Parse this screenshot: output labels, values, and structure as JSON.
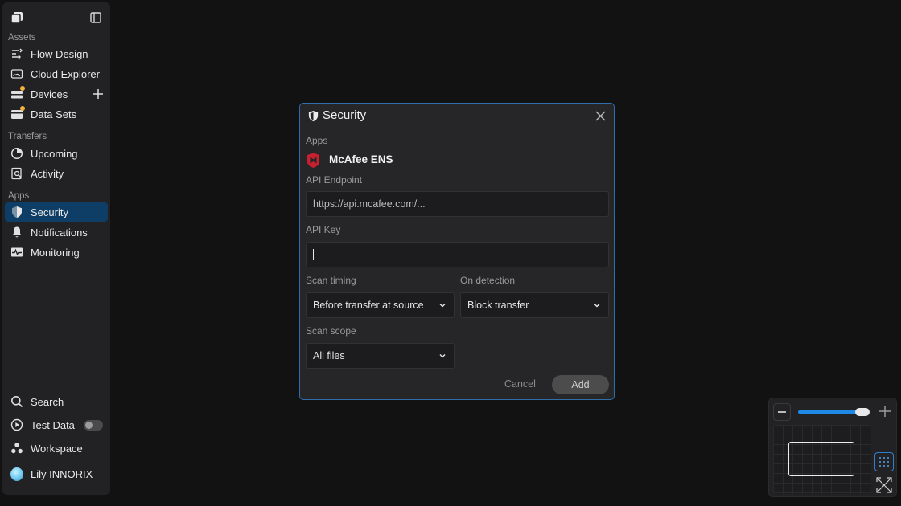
{
  "sidebar": {
    "sections": [
      {
        "label": "Assets"
      },
      {
        "label": "Transfers"
      },
      {
        "label": "Apps"
      }
    ],
    "items": [
      {
        "label": "Flow Design",
        "icon": "flow-icon"
      },
      {
        "label": "Cloud Explorer",
        "icon": "cloud-folder-icon"
      },
      {
        "label": "Devices",
        "icon": "devices-icon"
      },
      {
        "label": "Data Sets",
        "icon": "dataset-icon"
      },
      {
        "label": "Upcoming",
        "icon": "pie-clock-icon"
      },
      {
        "label": "Activity",
        "icon": "activity-icon"
      },
      {
        "label": "Security",
        "icon": "shield-icon",
        "active": true
      },
      {
        "label": "Notifications",
        "icon": "bell-icon"
      },
      {
        "label": "Monitoring",
        "icon": "monitor-icon"
      }
    ],
    "bottom": [
      {
        "label": "Search",
        "icon": "search-icon"
      },
      {
        "label": "Test Data",
        "icon": "play-circle-icon"
      },
      {
        "label": "Workspace",
        "icon": "workspace-icon"
      },
      {
        "label": "Lily INNORIX",
        "icon": "avatar"
      }
    ],
    "test_data_enabled": false
  },
  "dialog": {
    "title": "Security",
    "apps_label": "Apps",
    "app_name": "McAfee ENS",
    "endpoint_label": "API Endpoint",
    "endpoint_placeholder": "https://api.mcafee.com/...",
    "api_key_label": "API Key",
    "api_key_value": "",
    "scan_timing_label": "Scan timing",
    "scan_timing_value": "Before transfer at source",
    "on_detection_label": "On detection",
    "on_detection_value": "Block transfer",
    "scan_scope_label": "Scan scope",
    "scan_scope_value": "All files",
    "cancel_label": "Cancel",
    "add_label": "Add"
  },
  "colors": {
    "accent": "#1e88e5",
    "active_nav": "#0e3e66",
    "mcafee_red": "#c8202f",
    "badge_yellow": "#f2b33d"
  },
  "zoom": {
    "level_fraction": 0.9
  }
}
